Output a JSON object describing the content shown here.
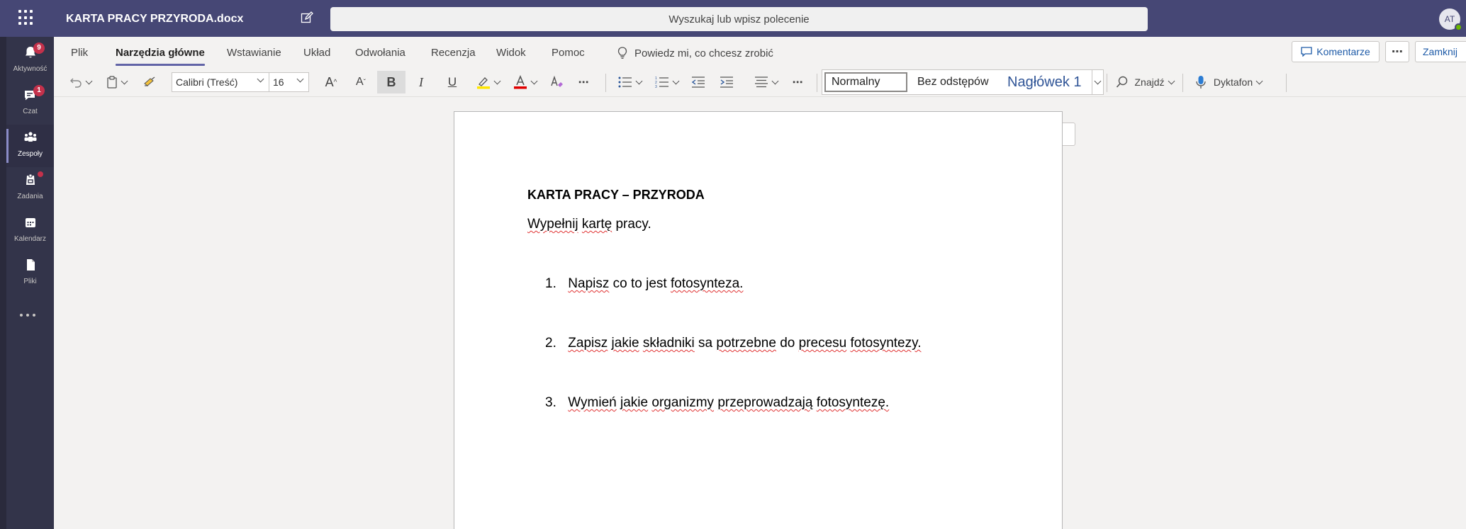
{
  "app": {
    "document_title": "KARTA PRACY PRZYRODA.docx",
    "search_placeholder": "Wyszukaj lub wpisz polecenie",
    "avatar_initials": "AT"
  },
  "rail": {
    "items": [
      {
        "label": "Aktywność",
        "icon": "bell-icon",
        "badge": "9"
      },
      {
        "label": "Czat",
        "icon": "chat-icon",
        "badge": "1"
      },
      {
        "label": "Zespoły",
        "icon": "teams-icon",
        "active": true
      },
      {
        "label": "Zadania",
        "icon": "assignments-icon",
        "dot": true
      },
      {
        "label": "Kalendarz",
        "icon": "calendar-icon"
      },
      {
        "label": "Pliki",
        "icon": "files-icon"
      }
    ]
  },
  "ribbon": {
    "tabs": [
      "Plik",
      "Narzędzia główne",
      "Wstawianie",
      "Układ",
      "Odwołania",
      "Recenzja",
      "Widok",
      "Pomoc"
    ],
    "active_tab": "Narzędzia główne",
    "tell_me": "Powiedz mi, co chcesz zrobić",
    "comments_label": "Komentarze",
    "close_label": "Zamknij",
    "font_name": "Calibri (Treść)",
    "font_size": "16",
    "grow_font_label": "A",
    "shrink_font_label": "A",
    "bold_label": "B",
    "italic_label": "I",
    "underline_label": "U",
    "more_glyph": "⋯",
    "styles": {
      "normal": "Normalny",
      "no_spacing": "Bez odstępów",
      "heading1": "Nagłówek 1"
    },
    "find_label": "Znajdź",
    "dictate_label": "Dyktafon"
  },
  "document": {
    "heading": "KARTA PRACY – PRZYRODA",
    "instruction_words": [
      "Wypełnij",
      "kartę",
      "pracy."
    ],
    "items": [
      {
        "number": "1.",
        "words": [
          "Napisz",
          "co",
          "to",
          "jest",
          "fotosynteza."
        ]
      },
      {
        "number": "2.",
        "words": [
          "Zapisz",
          "jakie",
          "składniki",
          "sa",
          "potrzebne",
          "do",
          "precesu",
          "fotosyntezy."
        ]
      },
      {
        "number": "3.",
        "words": [
          "Wymień",
          "jakie",
          "organizmy",
          "przeprowadzają",
          "fotosyntezę."
        ]
      }
    ]
  },
  "colors": {
    "header_bg": "#464775",
    "rail_bg": "#33344a",
    "accent": "#6264a7",
    "badge": "#c4314b",
    "spellcheck": "#e03131",
    "heading_style": "#2f5496"
  }
}
